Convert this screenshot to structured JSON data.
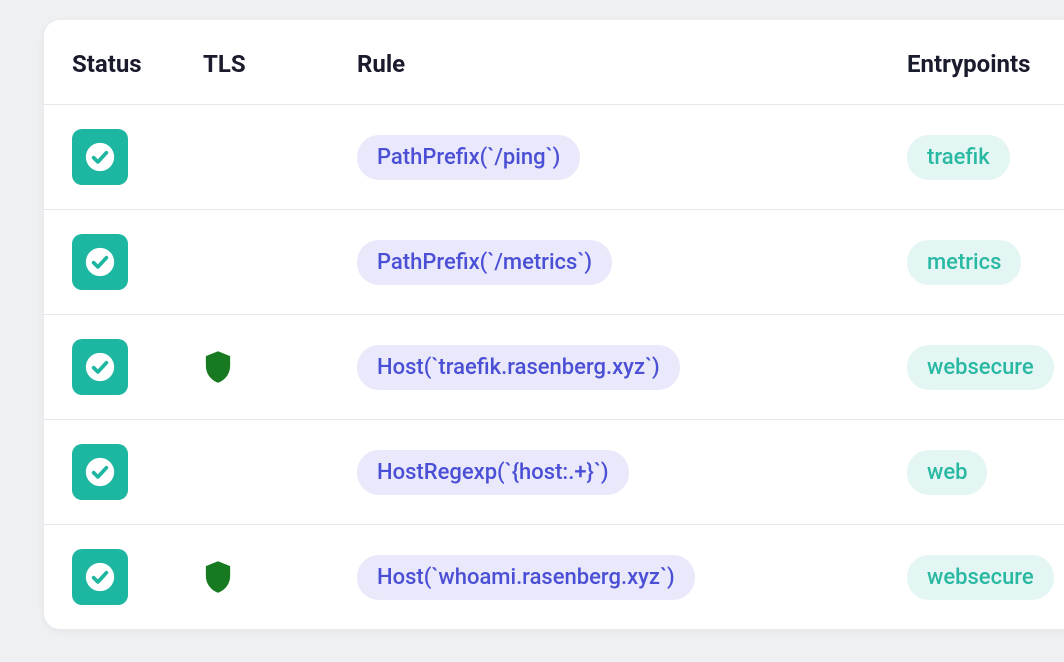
{
  "columns": {
    "status": "Status",
    "tls": "TLS",
    "rule": "Rule",
    "entrypoints": "Entrypoints"
  },
  "rows": [
    {
      "status": "ok",
      "tls": false,
      "rule": "PathPrefix(`/ping`)",
      "entrypoint": "traefik"
    },
    {
      "status": "ok",
      "tls": false,
      "rule": "PathPrefix(`/metrics`)",
      "entrypoint": "metrics"
    },
    {
      "status": "ok",
      "tls": true,
      "rule": "Host(`traefik.rasenberg.xyz`)",
      "entrypoint": "websecure"
    },
    {
      "status": "ok",
      "tls": false,
      "rule": "HostRegexp(`{host:.+}`)",
      "entrypoint": "web"
    },
    {
      "status": "ok",
      "tls": true,
      "rule": "Host(`whoami.rasenberg.xyz`)",
      "entrypoint": "websecure"
    }
  ]
}
